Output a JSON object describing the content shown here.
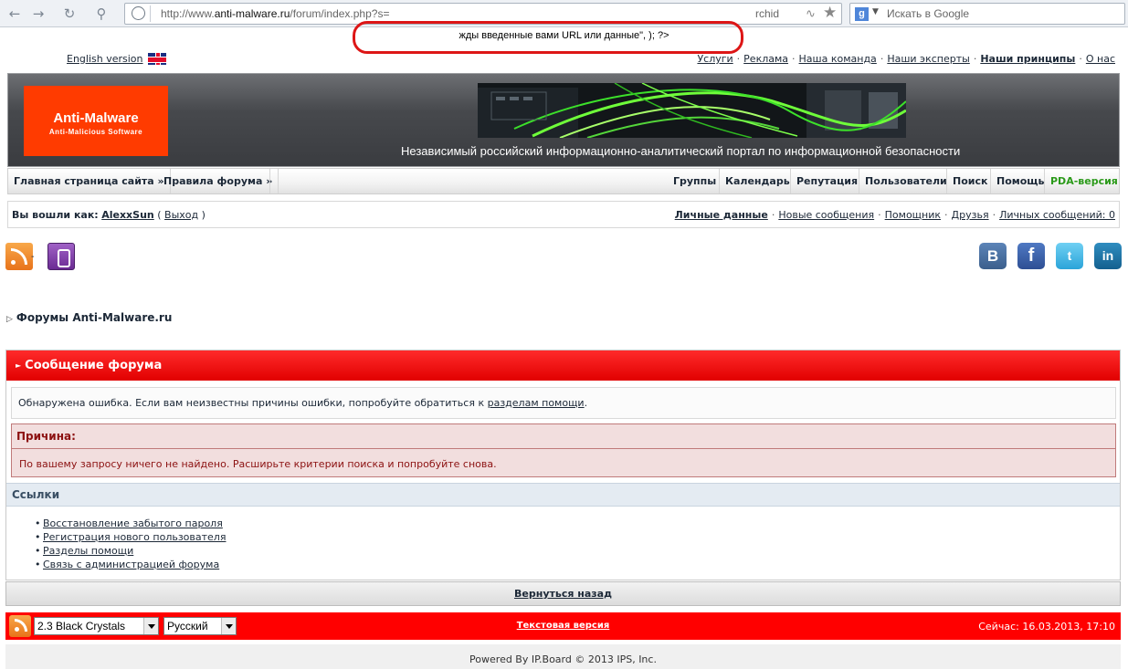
{
  "browser": {
    "url_prefix": "http://www.",
    "url_domain": "anti-malware.ru",
    "url_path": "/forum/index.php?s=",
    "url_tail": "rchid",
    "search_placeholder": "Искать в Google",
    "back_icon": "arrow-left-icon",
    "forward_icon": "arrow-right-icon",
    "reload_icon": "reload-icon",
    "key_icon": "key-icon"
  },
  "injected_text": "жды введенные вами URL или данные\", ); ?>",
  "header": {
    "english_version": "English version",
    "top_links": [
      "Услуги",
      "Реклама",
      "Наша команда",
      "Наши эксперты",
      "Наши принципы",
      "О нас"
    ],
    "logo_title": "Anti-Malware",
    "logo_subtitle": "Anti-Malicious Software",
    "tagline": "Независимый российский информационно-аналитический портал по информационной безопасности"
  },
  "navbar": {
    "left": [
      "Главная страница сайта »",
      "Правила форума »"
    ],
    "right": [
      "Группы",
      "Календарь",
      "Репутация",
      "Пользователи",
      "Поиск",
      "Помощь",
      "PDA-версия"
    ]
  },
  "userbar": {
    "logged_in_as": "Вы вошли как:",
    "username": "AlexxSun",
    "paren_open": "(",
    "logout": "Выход",
    "paren_close": ")",
    "links": [
      "Личные данные",
      "Новые сообщения",
      "Помощник",
      "Друзья",
      "Личных сообщений: 0"
    ]
  },
  "icons_row": {
    "dash": "-"
  },
  "social": {
    "vk": "B",
    "fb": "f",
    "tw": "t",
    "li": "in"
  },
  "breadcrumb": "Форумы Anti-Malware.ru",
  "message": {
    "title": "Сообщение форума",
    "error_text": "Обнаружена ошибка. Если вам неизвестны причины ошибки, попробуйте обратиться к ",
    "help_link": "разделам помощи",
    "error_end": ".",
    "reason_title": "Причина:",
    "reason_text": "По вашему запросу ничего не найдено. Расширьте критерии поиска и попробуйте снова.",
    "links_title": "Ссылки",
    "links": [
      "Восстановление забытого пароля",
      "Регистрация нового пользователя",
      "Разделы помощи",
      "Связь с администрацией форума"
    ],
    "back": "Вернуться назад"
  },
  "footer": {
    "skin": "2.3 Black Crystals",
    "language": "Русский",
    "text_version": "Текстовая версия",
    "now": "Сейчас: 16.03.2013, 17:10",
    "powered": "Powered By IP.Board © 2013  IPS, Inc."
  },
  "colors": {
    "accent_red": "#ff0000",
    "logo_orange": "#ff3b00",
    "pda_green": "#2b9a1a",
    "highlight_circle": "#dd1616"
  }
}
